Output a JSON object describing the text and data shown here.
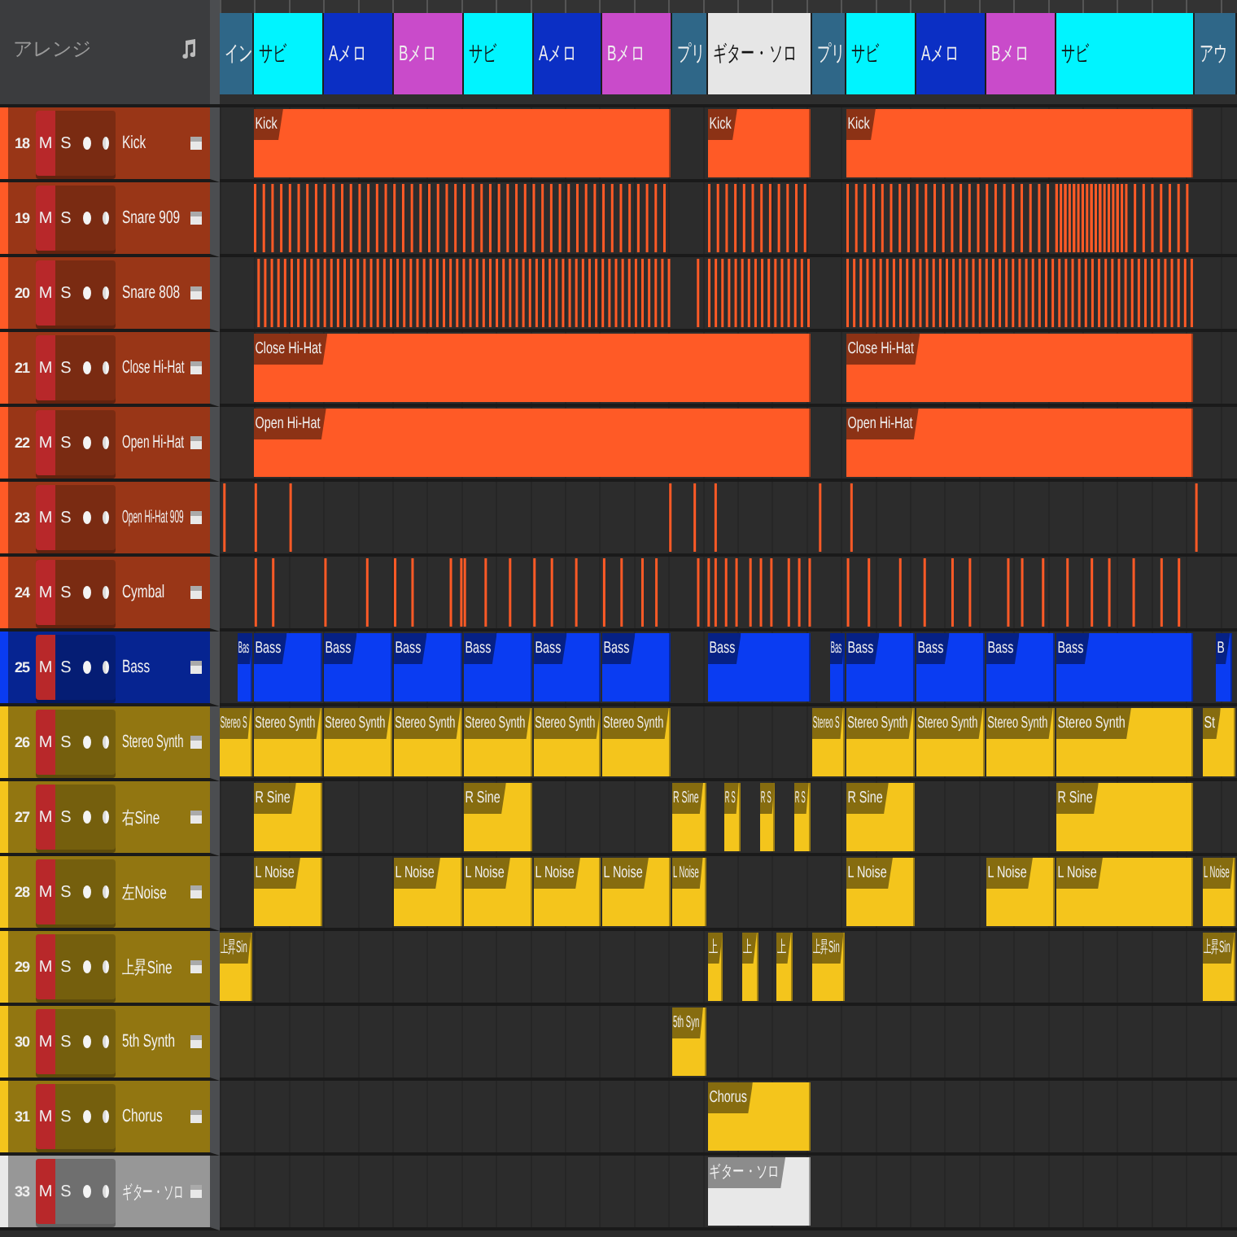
{
  "arrange_panel": {
    "title": "アレンジ"
  },
  "sections": [
    {
      "label": "イン",
      "color": "#2f6788"
    },
    {
      "label": "サビ",
      "color": "#00f4ff"
    },
    {
      "label": "Aメロ",
      "color": "#0b2fc4"
    },
    {
      "label": "Bメロ",
      "color": "#c94bca"
    },
    {
      "label": "サビ",
      "color": "#00f4ff"
    },
    {
      "label": "Aメロ",
      "color": "#0b2fc4"
    },
    {
      "label": "Bメロ",
      "color": "#c94bca"
    },
    {
      "label": "プリ",
      "color": "#2f6788"
    },
    {
      "label": "ギター・ソロ",
      "color": "#e6e6e6"
    },
    {
      "label": "プリ",
      "color": "#2f6788"
    },
    {
      "label": "サビ",
      "color": "#00f4ff"
    },
    {
      "label": "Aメロ",
      "color": "#0b2fc4"
    },
    {
      "label": "Bメロ",
      "color": "#c94bca"
    },
    {
      "label": "サビ",
      "color": "#00f4ff"
    },
    {
      "label": "アウ",
      "color": "#2f6788"
    }
  ],
  "tracks": [
    {
      "number": "18",
      "mute": "M",
      "solo": "S",
      "name": "Kick",
      "color": "#ff5a26",
      "clips": [
        {
          "label": "Kick"
        },
        {
          "label": "Kick"
        },
        {
          "label": "Kick"
        }
      ]
    },
    {
      "number": "19",
      "mute": "M",
      "solo": "S",
      "name": "Snare 909",
      "color": "#ff5a26"
    },
    {
      "number": "20",
      "mute": "M",
      "solo": "S",
      "name": "Snare 808",
      "color": "#ff5a26"
    },
    {
      "number": "21",
      "mute": "M",
      "solo": "S",
      "name": "Close Hi-Hat",
      "color": "#ff5a26",
      "clips": [
        {
          "label": "Close Hi-Hat"
        },
        {
          "label": "Close Hi-Hat"
        }
      ]
    },
    {
      "number": "22",
      "mute": "M",
      "solo": "S",
      "name": "Open Hi-Hat",
      "color": "#ff5a26",
      "clips": [
        {
          "label": "Open Hi-Hat"
        },
        {
          "label": "Open Hi-Hat"
        }
      ]
    },
    {
      "number": "23",
      "mute": "M",
      "solo": "S",
      "name": "Open Hi-Hat 909",
      "color": "#ff5a26"
    },
    {
      "number": "24",
      "mute": "M",
      "solo": "S",
      "name": "Cymbal",
      "color": "#ff5a26"
    },
    {
      "number": "25",
      "mute": "M",
      "solo": "S",
      "name": "Bass",
      "color": "#0a3cf2",
      "clips": [
        {
          "label": "Bas"
        },
        {
          "label": "Bass"
        },
        {
          "label": "Bass"
        },
        {
          "label": "Bass"
        },
        {
          "label": "Bass"
        },
        {
          "label": "Bass"
        },
        {
          "label": "Bass"
        },
        {
          "label": "Bass"
        },
        {
          "label": "Bas"
        },
        {
          "label": "Bass"
        },
        {
          "label": "Bass"
        },
        {
          "label": "Bass"
        },
        {
          "label": "Bass"
        },
        {
          "label": "B"
        }
      ]
    },
    {
      "number": "26",
      "mute": "M",
      "solo": "S",
      "name": "Stereo Synth",
      "color": "#f4c51c",
      "clips": [
        {
          "label": "Stereo S"
        },
        {
          "label": "Stereo Synth"
        },
        {
          "label": "Stereo Synth"
        },
        {
          "label": "Stereo Synth"
        },
        {
          "label": "Stereo Synth"
        },
        {
          "label": "Stereo Synth"
        },
        {
          "label": "Stereo Synth"
        },
        {
          "label": "Stereo S"
        },
        {
          "label": "Stereo Synth"
        },
        {
          "label": "Stereo Synth"
        },
        {
          "label": "Stereo Synth"
        },
        {
          "label": "Stereo Synth"
        },
        {
          "label": "St"
        }
      ]
    },
    {
      "number": "27",
      "mute": "M",
      "solo": "S",
      "name": "右Sine",
      "color": "#f4c51c",
      "clips": [
        {
          "label": "R Sine"
        },
        {
          "label": "R Sine"
        },
        {
          "label": "R Sine"
        },
        {
          "label": "R S"
        },
        {
          "label": "R S"
        },
        {
          "label": "R S"
        },
        {
          "label": "R Sine"
        },
        {
          "label": "R Sine"
        }
      ]
    },
    {
      "number": "28",
      "mute": "M",
      "solo": "S",
      "name": "左Noise",
      "color": "#f4c51c",
      "clips": [
        {
          "label": "L Noise"
        },
        {
          "label": "L Noise"
        },
        {
          "label": "L Noise"
        },
        {
          "label": "L Noise"
        },
        {
          "label": "L Noise"
        },
        {
          "label": "L Noise"
        },
        {
          "label": "L Noise"
        },
        {
          "label": "L Noise"
        },
        {
          "label": "L Noise"
        },
        {
          "label": "L Noise"
        }
      ]
    },
    {
      "number": "29",
      "mute": "M",
      "solo": "S",
      "name": "上昇Sine",
      "color": "#f4c51c",
      "clips": [
        {
          "label": "上昇Sin"
        },
        {
          "label": "上"
        },
        {
          "label": "上"
        },
        {
          "label": "上"
        },
        {
          "label": "上昇Sin"
        },
        {
          "label": "上昇Sin"
        }
      ]
    },
    {
      "number": "30",
      "mute": "M",
      "solo": "S",
      "name": "5th Synth",
      "color": "#f4c51c",
      "clips": [
        {
          "label": "5th Syn"
        }
      ]
    },
    {
      "number": "31",
      "mute": "M",
      "solo": "S",
      "name": "Chorus",
      "color": "#f4c51c",
      "clips": [
        {
          "label": "Chorus"
        }
      ]
    },
    {
      "number": "33",
      "mute": "M",
      "solo": "S",
      "name": "ギター・ソロ",
      "color": "#e8e8e8",
      "clips": [
        {
          "label": "ギター・ソロ"
        }
      ]
    }
  ]
}
